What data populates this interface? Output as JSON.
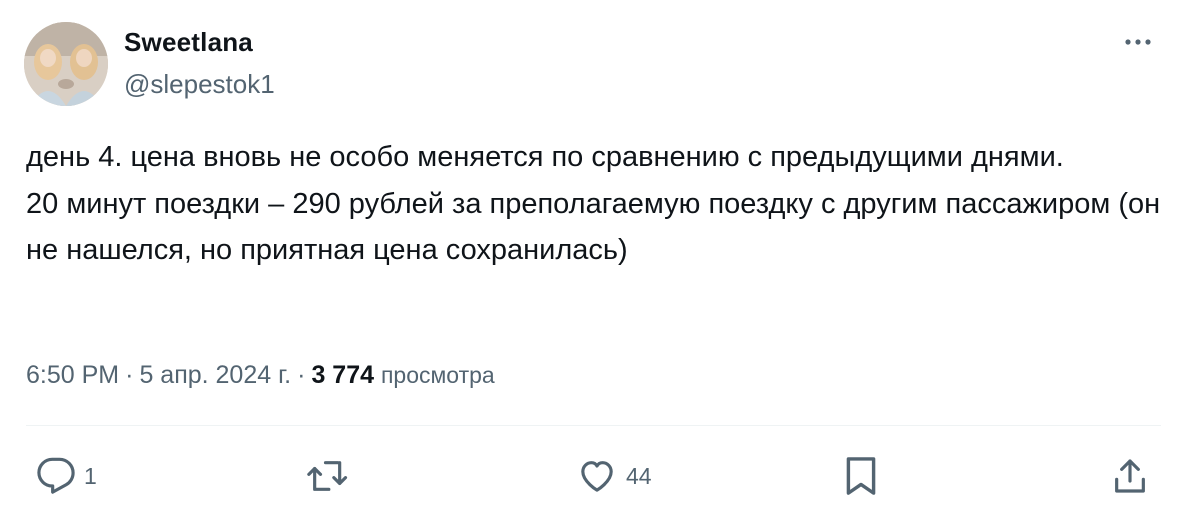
{
  "user": {
    "name": "Sweetlana",
    "handle": "@slepestok1"
  },
  "tweet": {
    "paragraph1": "день 4. цена вновь не особо меняется по сравнению с предыдущими днями.",
    "paragraph2": "20 минут поездки – 290 рублей за преполагаемую поездку с другим пассажиром (он не нашелся, но приятная цена сохранилась)"
  },
  "meta": {
    "time": "6:50 PM",
    "separator": "·",
    "date": "5 апр. 2024 г.",
    "views_count": "3 774",
    "views_label": "просмотра"
  },
  "actions": {
    "reply_count": "1",
    "retweet_count": "",
    "like_count": "44"
  },
  "icons": {
    "more": "more-horizontal-icon",
    "reply": "reply-icon",
    "retweet": "retweet-icon",
    "like": "heart-icon",
    "bookmark": "bookmark-icon",
    "share": "share-icon"
  },
  "colors": {
    "text_primary": "#0f1419",
    "text_secondary": "#536471",
    "divider": "#eff3f4"
  }
}
